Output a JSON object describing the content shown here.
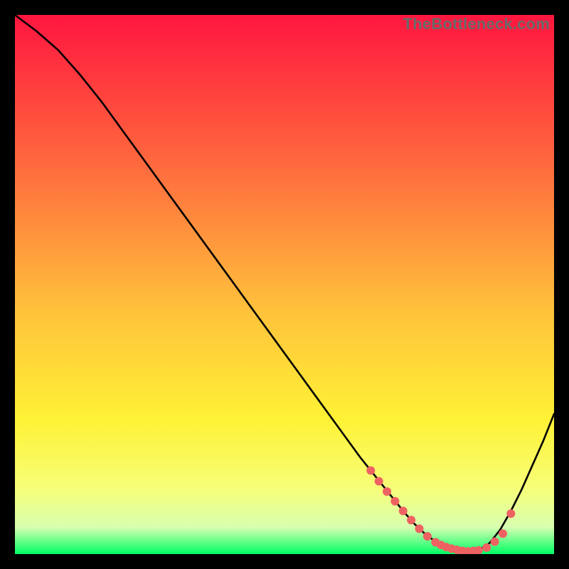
{
  "watermark": "TheBottleneck.com",
  "colors": {
    "black": "#000000",
    "curve": "#000000",
    "marker_fill": "#ef6262",
    "marker_stroke": "#d94e4e",
    "grad_top": "#ff163f",
    "grad_mid1": "#ff6a3e",
    "grad_mid2": "#ffc23b",
    "grad_mid3": "#fff235",
    "grad_mid4": "#f6ff7a",
    "grad_mid5": "#d8ffb0",
    "grad_bottom": "#00ff66"
  },
  "chart_data": {
    "type": "line",
    "title": "",
    "xlabel": "",
    "ylabel": "",
    "xlim": [
      0,
      100
    ],
    "ylim": [
      0,
      100
    ],
    "series": [
      {
        "name": "curve",
        "x": [
          0,
          4,
          8,
          12,
          16,
          20,
          24,
          28,
          32,
          36,
          40,
          44,
          48,
          52,
          56,
          60,
          64,
          66,
          68,
          70,
          72,
          74,
          76,
          78,
          80,
          82,
          84,
          86,
          88,
          90,
          92,
          94,
          96,
          98,
          100
        ],
        "y": [
          100,
          97,
          93.5,
          89,
          84,
          78.5,
          73,
          67.5,
          62,
          56.5,
          51,
          45.5,
          40,
          34.5,
          29,
          23.5,
          18,
          15.5,
          13,
          10.5,
          8,
          5.7,
          3.8,
          2.3,
          1.3,
          0.7,
          0.5,
          0.7,
          2,
          4.5,
          8,
          12,
          16.5,
          21,
          26
        ]
      }
    ],
    "markers": {
      "name": "bottleneck-markers",
      "x": [
        66.0,
        67.5,
        69.0,
        70.5,
        72.0,
        73.5,
        75.0,
        76.5,
        78.0,
        79.0,
        80.0,
        81.0,
        82.0,
        83.0,
        84.0,
        85.0,
        86.0,
        87.5,
        89.0,
        90.5,
        92.0
      ],
      "y": [
        15.5,
        13.5,
        11.6,
        9.8,
        8.0,
        6.3,
        4.7,
        3.3,
        2.2,
        1.7,
        1.3,
        1.0,
        0.8,
        0.6,
        0.5,
        0.6,
        0.7,
        1.2,
        2.3,
        3.8,
        7.5
      ]
    }
  }
}
